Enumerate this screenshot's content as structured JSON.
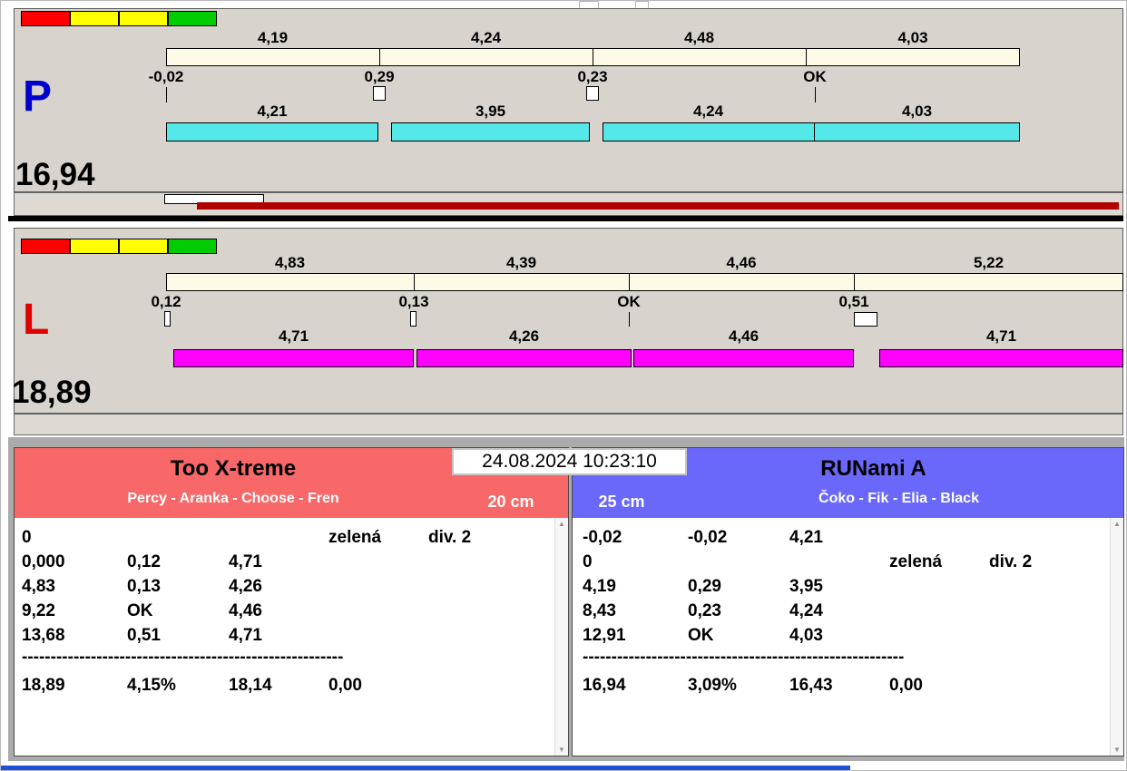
{
  "window": {
    "timestamp": "24.08.2024 10:23:10"
  },
  "colors": {
    "light_red": "#ff0000",
    "light_yellow": "#ffff00",
    "light_green": "#00cc00",
    "split_bar_bg": "#fdfbe8",
    "lane_p_letter": "#0000cc",
    "lane_p_run_bar": "#55e8e8",
    "lane_l_letter": "#e00000",
    "lane_l_run_bar": "#ff00ff",
    "progress_bar": "#b00000",
    "team_left_header": "#f86868",
    "team_right_header": "#6a68fa",
    "taskbar": "#1e4fd6"
  },
  "lane_p": {
    "letter": "P",
    "total": "16,94",
    "lights": [
      "#ff0000",
      "#ffff00",
      "#ffff00",
      "#00cc00"
    ],
    "split_values": [
      "4,19",
      "4,24",
      "4,48",
      "4,03"
    ],
    "change_values": [
      "-0,02",
      "0,29",
      "0,23",
      "OK"
    ],
    "run_values": [
      "4,21",
      "3,95",
      "4,24",
      "4,03"
    ]
  },
  "lane_l": {
    "letter": "L",
    "total": "18,89",
    "lights": [
      "#ff0000",
      "#ffff00",
      "#ffff00",
      "#00cc00"
    ],
    "split_values": [
      "4,83",
      "4,39",
      "4,46",
      "5,22"
    ],
    "change_values": [
      "0,12",
      "0,13",
      "OK",
      "0,51"
    ],
    "run_values": [
      "4,71",
      "4,26",
      "4,46",
      "4,71"
    ]
  },
  "team_left": {
    "name": "Too X-treme",
    "members": "Percy - Aranka - Choose - Fren",
    "category": "20 cm",
    "rows": [
      [
        "0",
        "",
        "",
        "zelená",
        "div. 2"
      ],
      [
        "0,000",
        "0,12",
        "4,71",
        "",
        ""
      ],
      [
        "4,83",
        "0,13",
        "4,26",
        "",
        ""
      ],
      [
        "9,22",
        "OK",
        "4,46",
        "",
        ""
      ],
      [
        "13,68",
        "0,51",
        "4,71",
        "",
        ""
      ]
    ],
    "divider": "--------------------------------------------------------",
    "summary_rows": [
      [
        "18,89",
        "4,15%",
        "18,14",
        "0,00",
        ""
      ]
    ]
  },
  "team_right": {
    "name": "RUNami A",
    "members": "Čoko - Fik - Elia - Black",
    "category": "25 cm",
    "rows": [
      [
        "-0,02",
        "-0,02",
        "4,21",
        "",
        ""
      ],
      [
        "0",
        "",
        "",
        "zelená",
        "div. 2"
      ],
      [
        "4,19",
        "0,29",
        "3,95",
        "",
        ""
      ],
      [
        "8,43",
        "0,23",
        "4,24",
        "",
        ""
      ],
      [
        "12,91",
        "OK",
        "4,03",
        "",
        ""
      ]
    ],
    "divider": "--------------------------------------------------------",
    "summary_rows": [
      [
        "16,94",
        "3,09%",
        "16,43",
        "0,00",
        ""
      ]
    ]
  }
}
